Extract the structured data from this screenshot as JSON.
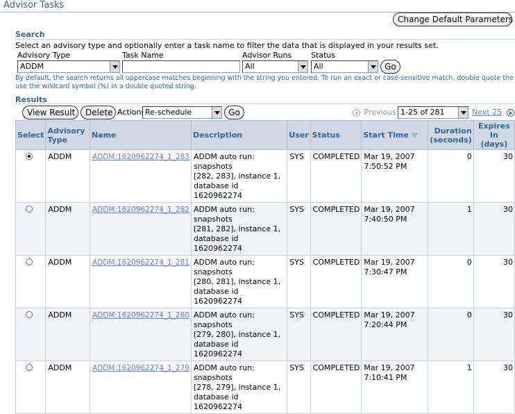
{
  "page_title": "Advisor Tasks",
  "change_default_button": "Change Default Parameters",
  "search": {
    "heading": "Search",
    "instructions": "Select an advisory type and optionally enter a task name to filter the data that is displayed in your results set.",
    "advisory_type_label": "Advisory Type",
    "advisory_type_value": "ADDM",
    "task_name_label": "Task Name",
    "task_name_value": "",
    "advisor_runs_label": "Advisor Runs",
    "advisor_runs_value": "All",
    "status_label": "Status",
    "status_value": "All",
    "go_label": "Go",
    "hint_line1": "By default, the search returns all uppercase matches beginning with the string you entered. To run an exact or case-sensitive match, double quote the search string. You can",
    "hint_line2": "use the wildcard symbol (%) in a double quoted string."
  },
  "results": {
    "heading": "Results",
    "view_result_label": "View Result",
    "delete_label": "Delete",
    "actions_label": "Actions",
    "actions_value": "Re-schedule",
    "go_label": "Go",
    "previous_label": "Previous",
    "range_value": "1-25 of 281",
    "next_label": "Next 25",
    "columns": {
      "select": "Select",
      "advisory_type_1": "Advisory",
      "advisory_type_2": "Type",
      "name": "Name",
      "description": "Description",
      "user": "User",
      "status": "Status",
      "start_time": "Start Time",
      "duration_1": "Duration",
      "duration_2": "(seconds)",
      "expires_1": "Expires In",
      "expires_2": "(days)"
    },
    "rows": [
      {
        "selected": true,
        "type": "ADDM",
        "name": "ADDM:1620962274_1_283",
        "desc1": "ADDM auto run: snapshots",
        "desc2": "[282, 283], instance 1,",
        "desc3": "database id 1620962274",
        "user": "SYS",
        "status": "COMPLETED",
        "date": "Mar 19, 2007",
        "time": "7:50:52 PM",
        "duration": "0",
        "expires": "30"
      },
      {
        "selected": false,
        "type": "ADDM",
        "name": "ADDM:1620962274_1_282",
        "desc1": "ADDM auto run: snapshots",
        "desc2": "[281, 282], instance 1,",
        "desc3": "database id 1620962274",
        "user": "SYS",
        "status": "COMPLETED",
        "date": "Mar 19, 2007",
        "time": "7:40:50 PM",
        "duration": "1",
        "expires": "30"
      },
      {
        "selected": false,
        "type": "ADDM",
        "name": "ADDM:1620962274_1_281",
        "desc1": "ADDM auto run: snapshots",
        "desc2": "[280, 281], instance 1,",
        "desc3": "database id 1620962274",
        "user": "SYS",
        "status": "COMPLETED",
        "date": "Mar 19, 2007",
        "time": "7:30:47 PM",
        "duration": "0",
        "expires": "30"
      },
      {
        "selected": false,
        "type": "ADDM",
        "name": "ADDM:1620962274_1_280",
        "desc1": "ADDM auto run: snapshots",
        "desc2": "[279, 280], instance 1,",
        "desc3": "database id 1620962274",
        "user": "SYS",
        "status": "COMPLETED",
        "date": "Mar 19, 2007",
        "time": "7:20:44 PM",
        "duration": "0",
        "expires": "30"
      },
      {
        "selected": false,
        "type": "ADDM",
        "name": "ADDM:1620962274_1_279",
        "desc1": "ADDM auto run: snapshots",
        "desc2": "[278, 279], instance 1,",
        "desc3": "database id 1620962274",
        "user": "SYS",
        "status": "COMPLETED",
        "date": "Mar 19, 2007",
        "time": "7:10:41 PM",
        "duration": "1",
        "expires": "30"
      }
    ]
  },
  "icons": {
    "previous": "previous-arrow-icon",
    "next": "next-arrow-icon",
    "sort": "sort-descending-icon",
    "dropdown": "chevron-down-icon"
  }
}
